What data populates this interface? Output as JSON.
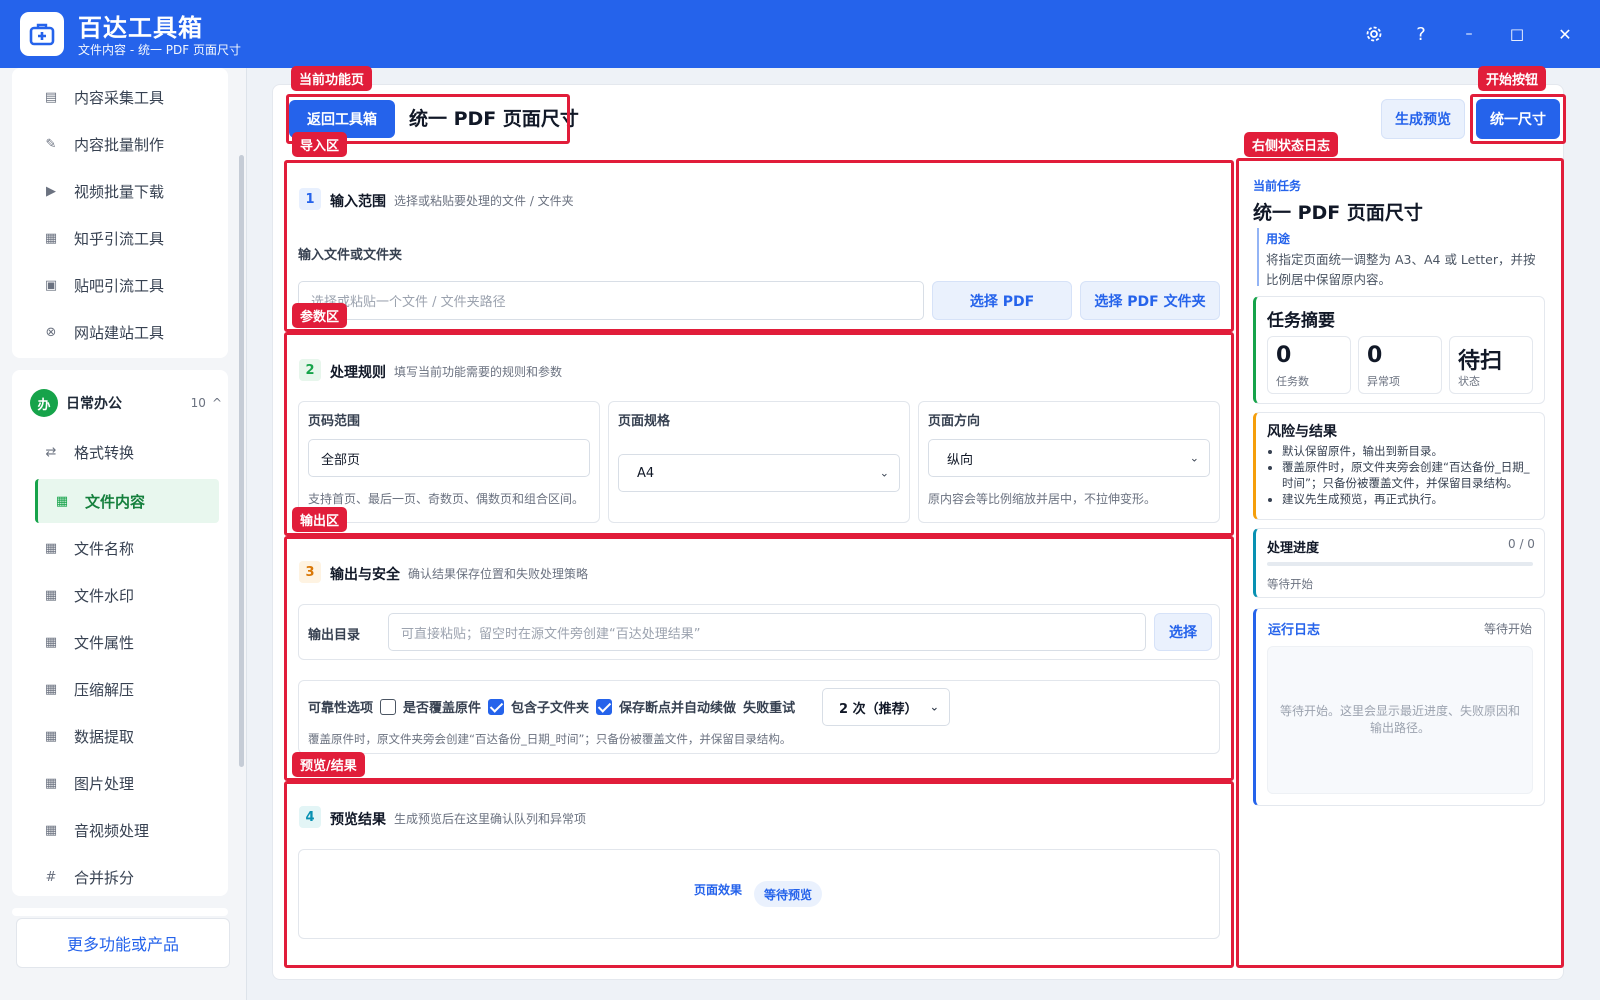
{
  "app": {
    "title": "百达工具箱",
    "subtitle": "文件内容 - 统一 PDF 页面尺寸",
    "brand_color": "#2563eb"
  },
  "window_controls": {
    "settings_icon": "gear-icon",
    "help": "?",
    "minimize": "–",
    "maximize": "□",
    "close": "✕"
  },
  "sidebar": {
    "top_items": [
      {
        "label": "内容采集工具",
        "icon": "doc-icon"
      },
      {
        "label": "内容批量制作",
        "icon": "pen-icon"
      },
      {
        "label": "视频批量下载",
        "icon": "video-icon"
      },
      {
        "label": "知乎引流工具",
        "icon": "zhihu-icon"
      },
      {
        "label": "贴吧引流工具",
        "icon": "tieba-icon"
      },
      {
        "label": "网站建站工具",
        "icon": "web-icon"
      }
    ],
    "group": {
      "badge": "办",
      "name": "日常办公",
      "count": "10",
      "chevron": "^"
    },
    "group_items": [
      {
        "label": "格式转换",
        "icon": "swap-icon"
      },
      {
        "label": "文件内容",
        "icon": "grid-icon",
        "active": true
      },
      {
        "label": "文件名称",
        "icon": "grid-icon"
      },
      {
        "label": "文件水印",
        "icon": "grid-icon"
      },
      {
        "label": "文件属性",
        "icon": "grid-icon"
      },
      {
        "label": "压缩解压",
        "icon": "grid-icon"
      },
      {
        "label": "数据提取",
        "icon": "grid-icon"
      },
      {
        "label": "图片处理",
        "icon": "grid-icon"
      },
      {
        "label": "音视频处理",
        "icon": "grid-icon"
      },
      {
        "label": "合并拆分",
        "icon": "hash-icon"
      }
    ],
    "more": "更多功能或产品"
  },
  "header": {
    "back": "返回工具箱",
    "title": "统一 PDF 页面尺寸",
    "preview": "生成预览",
    "start": "统一尺寸"
  },
  "annotations": {
    "current_page": "当前功能页",
    "start_button": "开始按钮",
    "import_area": "导入区",
    "right_log": "右侧状态日志",
    "param_area": "参数区",
    "output_area": "输出区",
    "preview_area": "预览/结果"
  },
  "step1": {
    "num": "1",
    "title": "输入范围",
    "desc": "选择或粘贴要处理的文件 / 文件夹",
    "field_label": "输入文件或文件夹",
    "placeholder": "选择或粘贴一个文件 / 文件夹路径",
    "btn_pdf": "选择 PDF",
    "btn_folder": "选择 PDF 文件夹"
  },
  "step2": {
    "num": "2",
    "title": "处理规则",
    "desc": "填写当前功能需要的规则和参数",
    "page_range": {
      "label": "页码范围",
      "value": "全部页",
      "hint": "支持首页、最后一页、奇数页、偶数页和组合区间。"
    },
    "page_size": {
      "label": "页面规格",
      "value": "A4"
    },
    "orientation": {
      "label": "页面方向",
      "value": "纵向",
      "hint": "原内容会等比例缩放并居中，不拉伸变形。"
    }
  },
  "step3": {
    "num": "3",
    "title": "输出与安全",
    "desc": "确认结果保存位置和失败处理策略",
    "out_label": "输出目录",
    "out_placeholder": "可直接粘贴；留空时在源文件旁创建“百达处理结果”",
    "out_btn": "选择",
    "reliability_label": "可靠性选项",
    "opt_overwrite": {
      "label": "是否覆盖原件",
      "checked": false
    },
    "opt_subfolder": {
      "label": "包含子文件夹",
      "checked": true
    },
    "opt_resume": {
      "label": "保存断点并自动续做",
      "checked": true
    },
    "retry_label": "失败重试",
    "retry_value": "2 次（推荐）",
    "note": "覆盖原件时，原文件夹旁会创建“百达备份_日期_时间”；只备份被覆盖文件，并保留目录结构。"
  },
  "step4": {
    "num": "4",
    "title": "预览结果",
    "desc": "生成预览后在这里确认队列和异常项",
    "effect_label": "页面效果",
    "status": "等待预览"
  },
  "right_panel": {
    "task_caption": "当前任务",
    "task_title": "统一 PDF 页面尺寸",
    "use_label": "用途",
    "use_text": "将指定页面统一调整为 A3、A4 或 Letter，并按比例居中保留原内容。",
    "summary_title": "任务摘要",
    "stats": [
      {
        "value": "0",
        "label": "任务数"
      },
      {
        "value": "0",
        "label": "异常项"
      },
      {
        "value": "待扫",
        "label": "状态"
      }
    ],
    "risk_title": "风险与结果",
    "risk_items": [
      "默认保留原件，输出到新目录。",
      "覆盖原件时，原文件夹旁会创建“百达备份_日期_时间”；只备份被覆盖文件，并保留目录结构。",
      "建议先生成预览，再正式执行。"
    ],
    "progress_title": "处理进度",
    "progress_count": "0 / 0",
    "progress_fraction": 0,
    "progress_status": "等待开始",
    "log_title": "运行日志",
    "log_status": "等待开始",
    "log_empty": "等待开始。这里会显示最近进度、失败原因和输出路径。"
  }
}
